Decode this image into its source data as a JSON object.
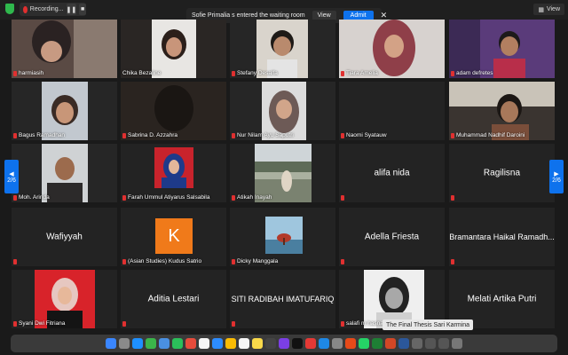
{
  "topbar": {
    "recording_label": "Recording...",
    "pause_icon": "pause-icon",
    "stop_icon": "stop-icon",
    "view_label": "View"
  },
  "notification": {
    "text": "Sofie Primalia s entered the waiting room",
    "view_label": "View",
    "admit_label": "Admit",
    "close_glyph": "✕"
  },
  "pager": {
    "prev_label": "2/6",
    "next_label": "2/6"
  },
  "participants": [
    {
      "name": "harmiasih",
      "muted": true
    },
    {
      "name": "Chika Bezaline",
      "muted": false
    },
    {
      "name": "Stefany Desalfa",
      "muted": true
    },
    {
      "name": "Tiara Amelia",
      "muted": true
    },
    {
      "name": "adam defretes",
      "muted": true
    },
    {
      "name": "Bagus Ramadhan",
      "muted": true
    },
    {
      "name": "Sabrina D. Azzahra",
      "muted": true
    },
    {
      "name": "Nur Nilam Ayu Saputri",
      "muted": true
    },
    {
      "name": "Naomi Syatauw",
      "muted": true
    },
    {
      "name": "Muhammad Nadhif Daroini",
      "muted": true
    },
    {
      "name": "Moh. Arinda",
      "muted": true
    },
    {
      "name": "Farah Ummul Atiyarus Salsabila",
      "muted": true
    },
    {
      "name": "Atikah Inayah",
      "muted": true
    },
    {
      "name": "alifa nida",
      "muted": true
    },
    {
      "name": "Ragilisna",
      "muted": true
    },
    {
      "name": "Wafiyyah",
      "muted": true
    },
    {
      "name": "(Asian Studies) Kudus Satrio",
      "muted": true
    },
    {
      "name": "Dicky Manggala",
      "muted": true
    },
    {
      "name": "Adella Friesta",
      "muted": true
    },
    {
      "name": "Bramantara Haikal Ramadh...",
      "muted": true
    },
    {
      "name": "Syani Dwi Fitriana",
      "muted": true
    },
    {
      "name": "Aditia Lestari",
      "muted": true
    },
    {
      "name": "SITI RADIBAH IMATUFARIQ",
      "muted": true
    },
    {
      "name": "salafi m hasna",
      "muted": true
    },
    {
      "name": "Melati Artika Putri",
      "muted": true
    }
  ],
  "avatar_letter": "K",
  "dock_tooltip": "The Final Thesis Sari Karmina"
}
